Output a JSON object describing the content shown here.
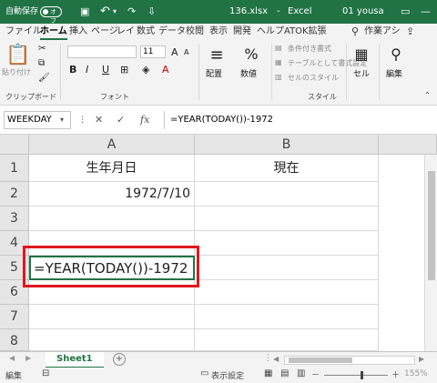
{
  "titlebar": {
    "autosave_label": "自動保存",
    "autosave_state": "オフ",
    "filename": "136.xlsx",
    "separator": "-",
    "app": "Excel",
    "user": "01 yousa"
  },
  "tabs": [
    "ファイル",
    "ホーム",
    "挿入",
    "ページ",
    "レイ",
    "数式",
    "データ",
    "校閲",
    "表示",
    "開発",
    "ヘルプ",
    "ATOK拡張",
    "作業アシ"
  ],
  "ribbon": {
    "groups": {
      "clipboard": "クリップボード",
      "font": "フォント",
      "style": "スタイル"
    },
    "paste_label": "貼り付け",
    "align_label": "配置",
    "number_label": "数値",
    "percent_symbol": "%",
    "font_size": "11",
    "font_bold": "B",
    "font_italic": "I",
    "font_underline": "U",
    "font_grow": "A",
    "font_shrink": "A",
    "font_color": "A",
    "style_items": [
      "条件付き書式",
      "テーブルとして書式設定",
      "セルのスタイル"
    ],
    "cell_label": "セル",
    "edit_label": "編集"
  },
  "formula_bar": {
    "name_box": "WEEKDAY",
    "cancel": "✕",
    "confirm": "✓",
    "fx": "fx",
    "formula": "=YEAR(TODAY())-1972"
  },
  "grid": {
    "columns": [
      "A",
      "B"
    ],
    "rows": [
      "1",
      "2",
      "3",
      "4",
      "5",
      "6",
      "7",
      "8"
    ],
    "A1": "生年月日",
    "B1": "現在",
    "A2": "1972/7/10",
    "A5": "=YEAR(TODAY())-1972"
  },
  "sheet": {
    "tab_name": "Sheet1",
    "add_sheet": "+"
  },
  "status": {
    "mode": "編集",
    "display_settings": "表示設定",
    "zoom": "155%",
    "zoom_out": "－",
    "zoom_in": "＋"
  }
}
